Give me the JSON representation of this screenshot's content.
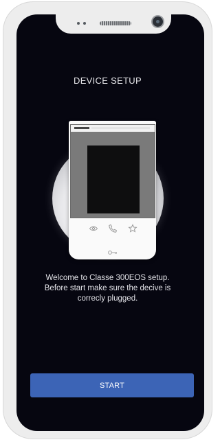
{
  "screen": {
    "title": "DEVICE SETUP",
    "welcome_line_1": "Welcome to Classe 300EOS setup.",
    "welcome_line_2": "Before start make sure the decive is",
    "welcome_line_3": "correcly plugged.",
    "start_label": "START"
  },
  "device_illustration": {
    "icons": [
      "eye-icon",
      "phone-handset-icon",
      "star-icon",
      "key-icon"
    ]
  },
  "colors": {
    "background": "#060610",
    "accent_button": "#3c64b6",
    "text": "#e6e6ea",
    "phone_frame": "#ededed"
  }
}
